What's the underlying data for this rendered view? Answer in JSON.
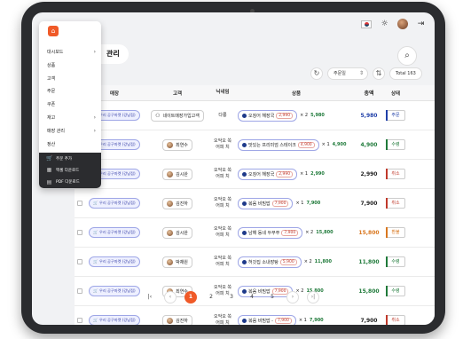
{
  "topbar": {
    "flag_icon": "korean-flag-icon",
    "theme_icon": "sun-icon",
    "logout_icon": "logout-icon"
  },
  "page": {
    "title": "관리",
    "search_icon": "search-icon"
  },
  "controls": {
    "sort_label": "주문일",
    "total": "Total 163"
  },
  "table": {
    "headers": {
      "store": "매장",
      "customer": "고객",
      "nickname": "닉네임",
      "product": "상품",
      "amount": "총액",
      "status": "상태"
    },
    "rows": [
      {
        "store": "우리 공구마켓 (강남점)",
        "customer": "네이트매장가입고객",
        "nickname": "다롱",
        "product": "오징어 해장국",
        "price": "2,990",
        "qty": "× 2",
        "sub": "5,980",
        "amount": "5,980",
        "status": "주문",
        "color": "blue",
        "cust_type": "icon"
      },
      {
        "store": "우리 공구마켓 (강남점)",
        "customer": "최연수",
        "nickname": "오악오 쏙 어피 치",
        "product": "맛있는 프리미엄 스테이크",
        "price": "4,900",
        "qty": "× 1",
        "sub": "4,900",
        "amount": "4,900",
        "status": "수령",
        "color": "green",
        "cust_type": "avatar"
      },
      {
        "store": "우리 공구마켓 (강남점)",
        "customer": "김시완",
        "nickname": "오악오 쏙 어피 치",
        "product": "오징어 해장국",
        "price": "2,990",
        "qty": "× 1",
        "sub": "2,990",
        "amount": "2,990",
        "status": "취소",
        "color": "red",
        "cust_type": "avatar"
      },
      {
        "store": "우리 공구마켓 (강남점)",
        "customer": "김진하",
        "nickname": "오악오 쏙 어피 치",
        "product": "볶음 비빔밥",
        "price": "7,900",
        "qty": "× 1",
        "sub": "7,900",
        "amount": "7,900",
        "status": "취소",
        "color": "red",
        "cust_type": "avatar"
      },
      {
        "store": "우리 공구마켓 (강남점)",
        "customer": "김시완",
        "nickname": "오악오 쏙 어피 치",
        "product": "남해 동네 두부쭈",
        "price": "7,900",
        "qty": "× 2",
        "sub": "15,800",
        "amount": "15,800",
        "status": "환불",
        "color": "orange",
        "cust_type": "avatar"
      },
      {
        "store": "우리 공구마켓 (강남점)",
        "customer": "박채원",
        "nickname": "오악오 쏙 어피 치",
        "product": "허갓집 소내장탕",
        "price": "5,900",
        "qty": "× 2",
        "sub": "11,800",
        "amount": "11,800",
        "status": "수령",
        "color": "green",
        "cust_type": "avatar"
      },
      {
        "store": "우리 공구마켓 (강남점)",
        "customer": "최연수",
        "nickname": "오악오 쏙 어피 치",
        "product": "볶음 비빔밥",
        "price": "7,900",
        "qty": "× 2",
        "sub": "15,800",
        "amount": "15,800",
        "status": "수령",
        "color": "green",
        "cust_type": "avatar"
      },
      {
        "store": "우리 공구마켓 (강남점)",
        "customer": "김진하",
        "nickname": "오악오 쏙 어피 치",
        "product": "볶음 비빔밥 -",
        "price": "7,900",
        "qty": "× 1",
        "sub": "7,900",
        "amount": "7,900",
        "status": "취소",
        "color": "red",
        "cust_type": "avatar"
      }
    ]
  },
  "pager": {
    "pages": [
      "1",
      "2",
      "3",
      "4",
      "5"
    ]
  },
  "menu": {
    "items": [
      {
        "label": "대시보드",
        "arrow": true
      },
      {
        "label": "상품",
        "arrow": false
      },
      {
        "label": "고객",
        "arrow": false
      },
      {
        "label": "주문",
        "arrow": false
      },
      {
        "label": "쿠폰",
        "arrow": false
      },
      {
        "label": "재고",
        "arrow": true
      },
      {
        "label": "매장 관리",
        "arrow": true
      },
      {
        "label": "정산",
        "arrow": false
      }
    ],
    "footer": [
      {
        "label": "주문 추가",
        "icon": "cart-icon"
      },
      {
        "label": "엑셀 다운로드",
        "icon": "excel-icon"
      },
      {
        "label": "PDF 다운로드",
        "icon": "pdf-icon"
      }
    ]
  }
}
